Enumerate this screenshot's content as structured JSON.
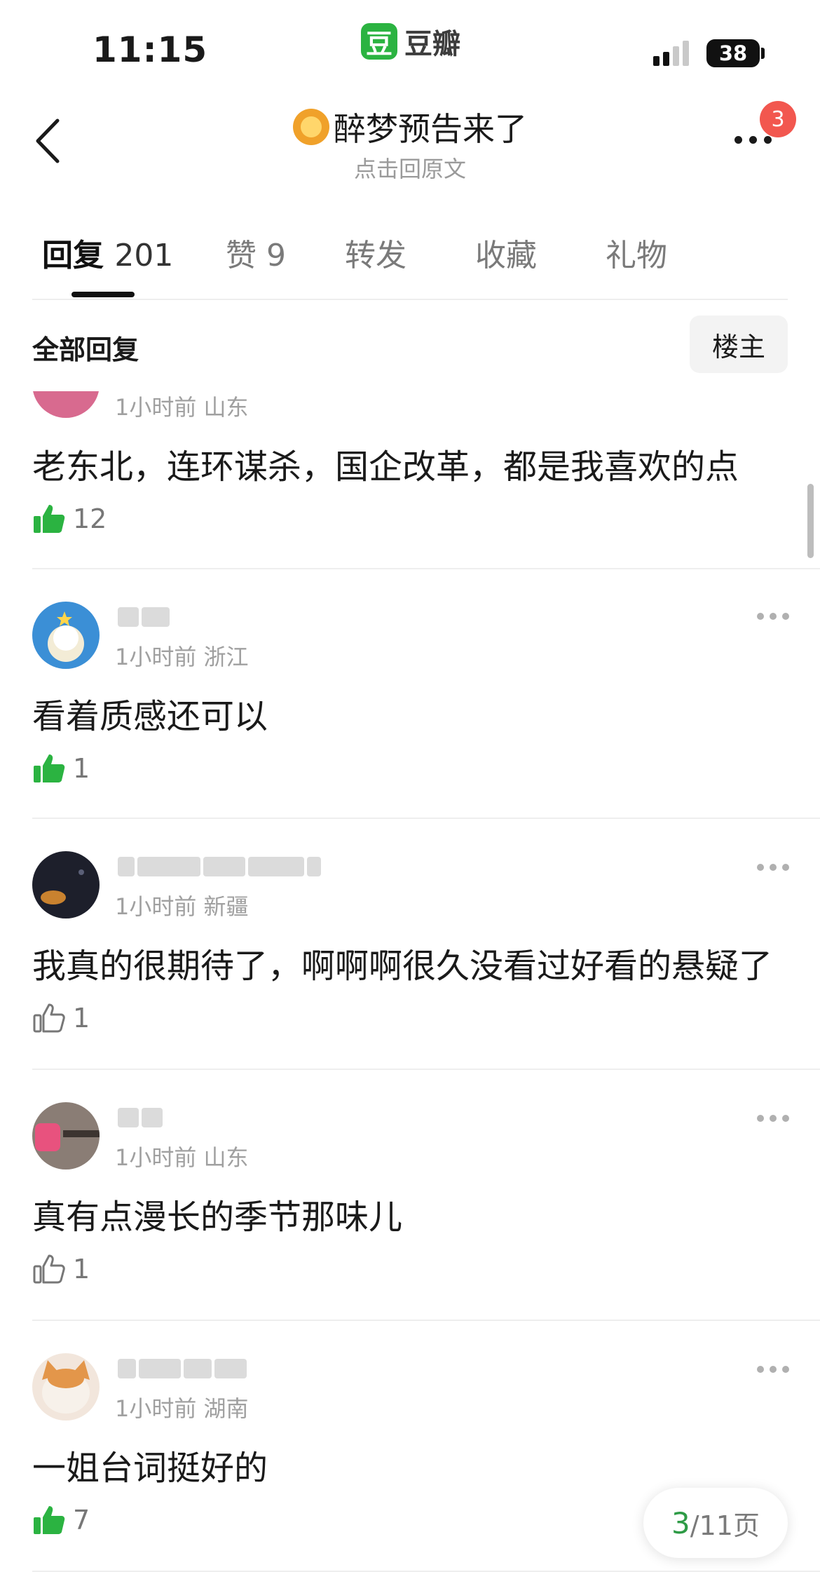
{
  "status_bar": {
    "time": "11:15",
    "battery": "38"
  },
  "app": {
    "icon_char": "豆",
    "name": "豆瓣"
  },
  "nav": {
    "title": "醉梦预告来了",
    "subtitle": "点击回原文",
    "notification_count": "3"
  },
  "tabs": [
    {
      "label": "回复",
      "count": "201",
      "active": true
    },
    {
      "label": "赞",
      "count": "9"
    },
    {
      "label": "转发",
      "count": ""
    },
    {
      "label": "收藏",
      "count": ""
    },
    {
      "label": "礼物",
      "count": ""
    }
  ],
  "section": {
    "title": "全部回复",
    "op_button": "楼主"
  },
  "comments": [
    {
      "meta": "1小时前 山东",
      "text": "老东北，连环谋杀，国企改革，都是我喜欢的点",
      "likes": "12",
      "liked": true
    },
    {
      "meta": "1小时前 浙江",
      "text": "看着质感还可以",
      "likes": "1",
      "liked": true
    },
    {
      "meta": "1小时前 新疆",
      "text": "我真的很期待了，啊啊啊很久没看过好看的悬疑了",
      "likes": "1",
      "liked": false
    },
    {
      "meta": "1小时前 山东",
      "text": "真有点漫长的季节那味儿",
      "likes": "1",
      "liked": false
    },
    {
      "meta": "1小时前 湖南",
      "text": "一姐台词挺好的",
      "likes": "7",
      "liked": true
    }
  ],
  "pager": {
    "current": "3",
    "total": "/11页"
  },
  "colors": {
    "brand_green": "#2bb341",
    "liked_green": "#2bb341",
    "badge_red": "#f2574f"
  }
}
